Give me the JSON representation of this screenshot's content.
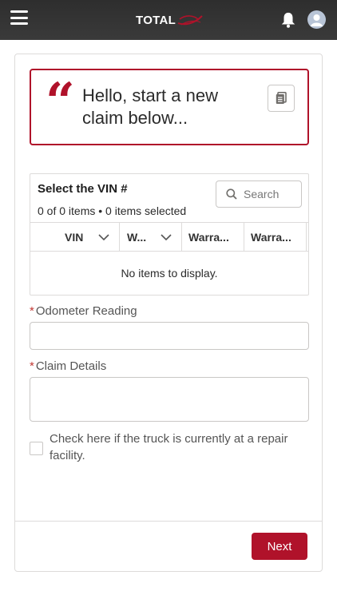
{
  "header": {
    "logo_text": "TOTAL",
    "logo_accent_color": "#b0122a",
    "menu_icon": "hamburger-icon",
    "notifications_icon": "bell-icon",
    "profile_icon": "avatar-icon"
  },
  "hello": {
    "text": "Hello, start a new claim below...",
    "quote_glyph": "“",
    "action_icon": "copy-icon"
  },
  "vin_table": {
    "title": "Select the VIN #",
    "count_text": "0 of 0 items • 0 items selected",
    "search_placeholder": "Search",
    "columns": [
      "VIN",
      "W...",
      "Warra...",
      "Warra..."
    ],
    "empty_text": "No items to display."
  },
  "form": {
    "required_mark": "*",
    "odometer_label": "Odometer Reading",
    "odometer_value": "",
    "claim_label": "Claim Details",
    "claim_value": "",
    "checkbox_label": "Check here if the truck is currently at a repair facility.",
    "checkbox_checked": false
  },
  "footer": {
    "next_label": "Next"
  },
  "colors": {
    "brand_red": "#b0122a",
    "header_bg": "#333333",
    "border": "#dddbda"
  }
}
